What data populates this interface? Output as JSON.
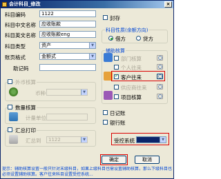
{
  "window": {
    "title": "会计科目_修改",
    "close_glyph": "×"
  },
  "form": {
    "code_label": "科目编码",
    "code_value": "1122",
    "name_cn_label": "科目中文名称",
    "name_cn_value": "应收账款",
    "name_en_label": "科目英文名称",
    "name_en_value": "应收账款eng",
    "type_label": "科目类型",
    "type_value": "资产",
    "format_label": "账页格式",
    "format_value": "金额式",
    "mnemonic_label": "助记码",
    "mnemonic_value": ""
  },
  "seal": {
    "label": "封存",
    "checked": false
  },
  "property_group": {
    "legend": "科目性质(余额方向)",
    "options": [
      {
        "label": "借方",
        "selected": true
      },
      {
        "label": "贷方",
        "selected": false
      }
    ]
  },
  "aux_group": {
    "legend": "辅助核算",
    "items": [
      {
        "label": "部门核算",
        "checked": false,
        "enabled": false
      },
      {
        "label": "个人往来",
        "checked": false,
        "enabled": false
      },
      {
        "label": "客户往来",
        "checked": true,
        "enabled": true
      },
      {
        "label": "供应商往来",
        "checked": false,
        "enabled": false
      },
      {
        "label": "项目核算",
        "checked": false,
        "enabled": true
      }
    ]
  },
  "foreign": {
    "label": "外币核算",
    "currency_label": "币种",
    "checked": false
  },
  "quantity": {
    "label": "数量核算",
    "unit_label": "计量单位",
    "checked": false
  },
  "summary": {
    "label": "汇总打印",
    "to_label": "汇总到",
    "value": "1122",
    "checked": false
  },
  "journals": [
    {
      "label": "日记账",
      "checked": false
    },
    {
      "label": "银行账",
      "checked": false
    }
  ],
  "controlled_system": {
    "label": "受控系统",
    "value": ""
  },
  "buttons": {
    "ok": "确定",
    "cancel": "取消"
  },
  "hint": "提示：辅助核算设置一般只针对末级科目，如果上级科目也需设置辅助核算，那么下级科目也必须设置辅助核算。客户往来科目设置受控系统...",
  "colors": {
    "highlight": "#d90000",
    "title_bar": "#0a246a",
    "accent": "#0046d5"
  }
}
